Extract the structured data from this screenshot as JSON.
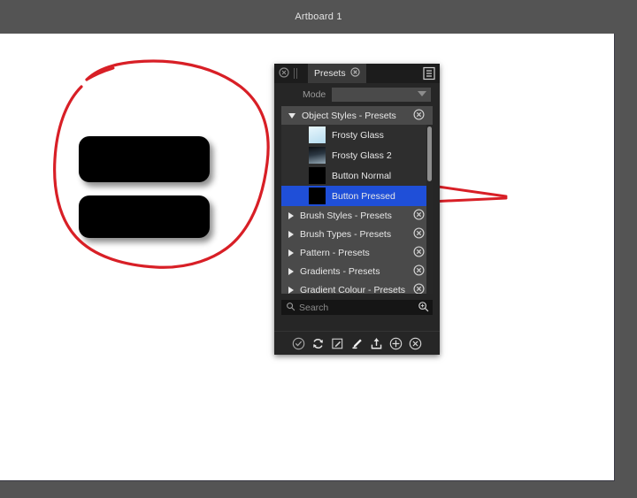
{
  "window": {
    "title": "Artboard 1",
    "background_color": "#545454",
    "canvas_color": "#ffffff"
  },
  "artwork": {
    "shapes": [
      {
        "name": "Button Normal shape",
        "fill": "#000000"
      },
      {
        "name": "Button Pressed shape",
        "fill": "#000000"
      }
    ],
    "annotation_color": "#d81f26",
    "annotation_note": "red hand-drawn circle around the two buttons and two red arrows pointing at list rows"
  },
  "panel": {
    "tab": {
      "label": "Presets",
      "close_icon": "close-circle-icon",
      "tab_close_icon": "close-circle-icon",
      "menu_icon": "hamburger-menu-icon"
    },
    "mode": {
      "label": "Mode",
      "value": "",
      "chevron_icon": "chevron-down-icon"
    },
    "sections": [
      {
        "label": "Object Styles - Presets",
        "expanded": true,
        "triangle": "triangle-down-icon",
        "close_icon": "close-circle-icon",
        "items": [
          {
            "label": "Frosty Glass",
            "swatch": "#c9e9f6",
            "selected": false
          },
          {
            "label": "Frosty Glass 2",
            "swatch": "#40505c",
            "selected": false
          },
          {
            "label": "Button Normal",
            "swatch": "#000000",
            "selected": false
          },
          {
            "label": "Button Pressed",
            "swatch": "#000000",
            "selected": true
          }
        ]
      },
      {
        "label": "Brush Styles - Presets",
        "expanded": false,
        "triangle": "triangle-right-icon",
        "close_icon": "close-circle-icon",
        "items": []
      },
      {
        "label": "Brush Types - Presets",
        "expanded": false,
        "triangle": "triangle-right-icon",
        "close_icon": "close-circle-icon",
        "items": []
      },
      {
        "label": "Pattern - Presets",
        "expanded": false,
        "triangle": "triangle-right-icon",
        "close_icon": "close-circle-icon",
        "items": []
      },
      {
        "label": "Gradients - Presets",
        "expanded": false,
        "triangle": "triangle-right-icon",
        "close_icon": "close-circle-icon",
        "items": []
      },
      {
        "label": "Gradient Colour - Presets",
        "expanded": false,
        "triangle": "triangle-right-icon",
        "close_icon": "close-circle-icon",
        "items": []
      }
    ],
    "search": {
      "placeholder": "Search",
      "value": "",
      "left_icon": "search-icon",
      "right_icon": "search-zoom-icon"
    },
    "toolbar_icons": [
      "check-circle-icon",
      "refresh-icon",
      "edit-square-icon",
      "pen-icon",
      "upload-icon",
      "plus-circle-icon",
      "close-circle-icon"
    ],
    "selection_color": "#1f4fd8"
  }
}
